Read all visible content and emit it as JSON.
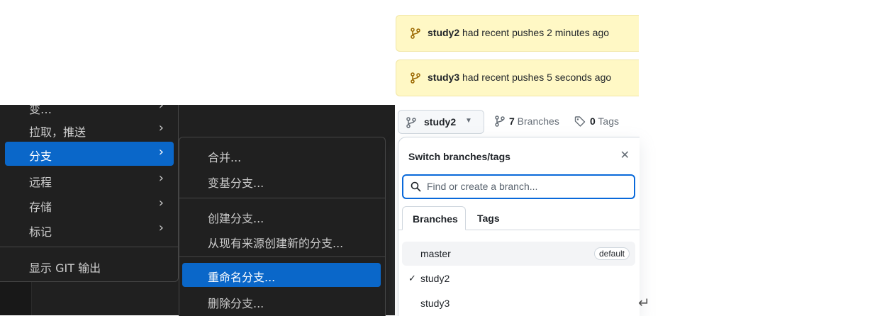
{
  "vscode_menu": {
    "partial_top": "变…",
    "items": [
      {
        "label": "拉取，推送"
      },
      {
        "label": "分支"
      },
      {
        "label": "远程"
      },
      {
        "label": "存储"
      },
      {
        "label": "标记"
      }
    ],
    "show_output": "显示 GIT 输出",
    "submenu": {
      "items": [
        "合并...",
        "变基分支...",
        "创建分支...",
        "从现有来源创建新的分支...",
        "重命名分支...",
        "删除分支..."
      ]
    },
    "chevron": "›"
  },
  "github": {
    "banners": [
      {
        "branch": "study2",
        "text": " had recent pushes 2 minutes ago"
      },
      {
        "branch": "study3",
        "text": " had recent pushes 5 seconds ago"
      }
    ],
    "current_branch": "study2",
    "branches_count": "7",
    "branches_label": " Branches",
    "tags_count": "0",
    "tags_label": " Tags",
    "dropdown": {
      "title": "Switch branches/tags",
      "search_placeholder": "Find or create a branch...",
      "tabs": [
        "Branches",
        "Tags"
      ],
      "branches": [
        {
          "name": "master",
          "badge": "default"
        },
        {
          "name": "study2",
          "checked": "✓"
        },
        {
          "name": "study3"
        }
      ]
    }
  },
  "return_glyph": "↵",
  "colors": {
    "accent_blue": "#0a67c9",
    "banner_yellow": "#fff8c5",
    "github_blue": "#0969da"
  }
}
